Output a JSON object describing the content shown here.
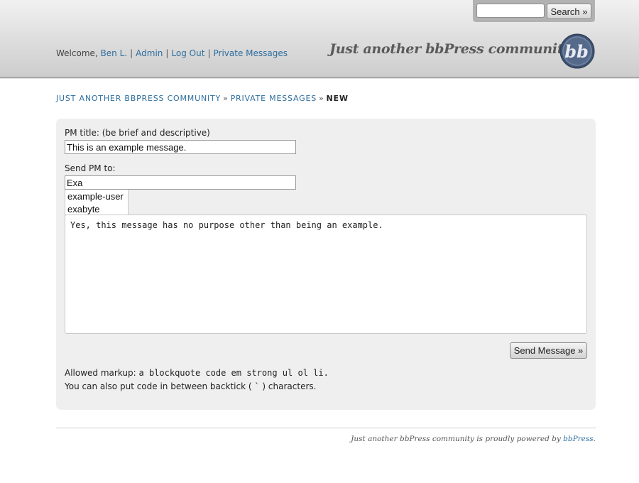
{
  "header": {
    "search_button": "Search »",
    "search_value": "",
    "welcome_prefix": "Welcome,",
    "user_name": "Ben L.",
    "nav": [
      "Admin",
      "Log Out",
      "Private Messages"
    ],
    "site_title": "Just another bbPress community",
    "logo_text": "bb",
    "logo_icon": "bbpress-logo-icon"
  },
  "breadcrumb": {
    "items": [
      "Just another bbPress community",
      "Private Messages"
    ],
    "separator": "»",
    "current": "New"
  },
  "form": {
    "title_label": "PM title: (be brief and descriptive)",
    "title_value": "This is an example message.",
    "to_label": "Send PM to:",
    "to_value": "Exa",
    "autocomplete": [
      "example-user",
      "exabyte"
    ],
    "message": "Yes, this message has no purpose other than being an example.",
    "send_button": "Send Message »",
    "allowed_markup_label": "Allowed markup:",
    "allowed_markup_tags": "a blockquote code em strong ul ol li.",
    "backtick_prefix": "You can also put code in between backtick (",
    "backtick_char": "`",
    "backtick_suffix": ") characters."
  },
  "footer": {
    "text": "Just another bbPress community is proudly powered by",
    "link": "bbPress",
    "period": "."
  },
  "colors": {
    "link": "#2e6e9e",
    "header_bg": "#d9d9d9",
    "panel_bg": "#efefef"
  }
}
